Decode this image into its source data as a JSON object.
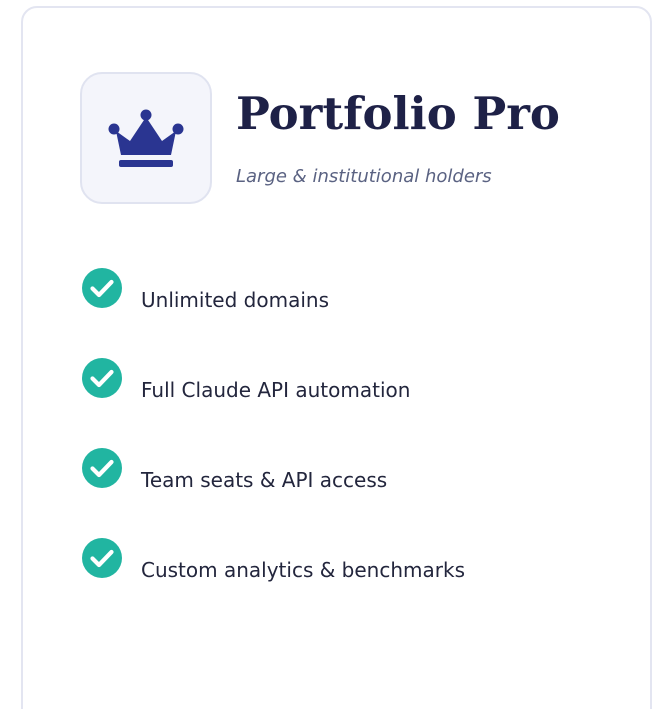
{
  "plan": {
    "icon": "crown-icon",
    "title": "Portfolio Pro",
    "subtitle": "Large & institutional holders"
  },
  "features": [
    {
      "label": "Unlimited domains",
      "icon": "check-circle-icon"
    },
    {
      "label": "Full Claude API automation",
      "icon": "check-circle-icon"
    },
    {
      "label": "Team seats & API access",
      "icon": "check-circle-icon"
    },
    {
      "label": "Custom analytics & benchmarks",
      "icon": "check-circle-icon"
    }
  ],
  "colors": {
    "title": "#1e2147",
    "subtitle": "#5a6282",
    "crown": "#2a3591",
    "check": "#21b5a1",
    "card_border": "#e3e5f1",
    "tile_background": "#f4f5fb"
  }
}
